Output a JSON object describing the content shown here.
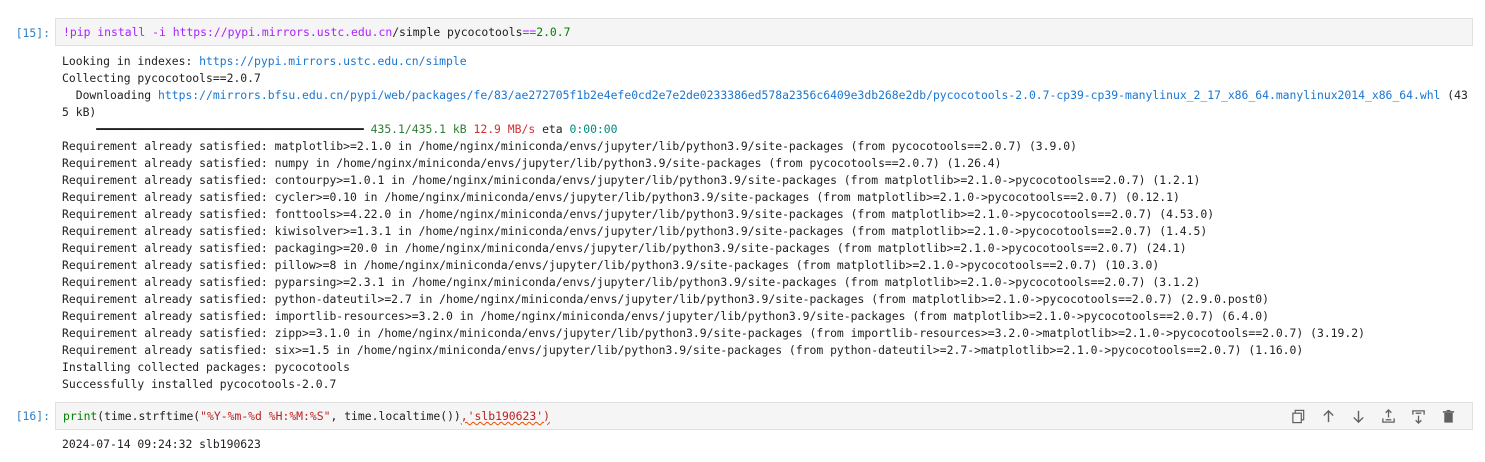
{
  "cell1": {
    "prompt": "[15]:",
    "code": {
      "magic": "!pip install -i https:",
      "sep": "//",
      "host": "pypi.mirrors.ustc.edu.cn",
      "path": "/simple pycocotools",
      "op": "==",
      "version": "2.0.7"
    },
    "output": {
      "looking_prefix": "Looking in indexes: ",
      "looking_url": "https://pypi.mirrors.ustc.edu.cn/simple",
      "collecting": "Collecting pycocotools==2.0.7",
      "downloading_prefix": "  Downloading ",
      "downloading_url": "https://mirrors.bfsu.edu.cn/pypi/web/packages/fe/83/ae272705f1b2e4efe0cd2e7e2de0233386ed578a2356c6409e3db268e2db/pycocotools-2.0.7-cp39-cp39-manylinux_2_17_x86_64.manylinux2014_x86_64.whl",
      "downloading_suffix": " (435 kB)",
      "progress": {
        "bar": "     ━━━━━━━━━━━━━━━━━━━━━━━━━━━━━━━━━━━━━━━ ",
        "size": "435.1/435.1 kB",
        "speed": "12.9 MB/s",
        "eta_label": "eta",
        "eta": "0:00:00"
      },
      "lines": [
        "Requirement already satisfied: matplotlib>=2.1.0 in /home/nginx/miniconda/envs/jupyter/lib/python3.9/site-packages (from pycocotools==2.0.7) (3.9.0)",
        "Requirement already satisfied: numpy in /home/nginx/miniconda/envs/jupyter/lib/python3.9/site-packages (from pycocotools==2.0.7) (1.26.4)",
        "Requirement already satisfied: contourpy>=1.0.1 in /home/nginx/miniconda/envs/jupyter/lib/python3.9/site-packages (from matplotlib>=2.1.0->pycocotools==2.0.7) (1.2.1)",
        "Requirement already satisfied: cycler>=0.10 in /home/nginx/miniconda/envs/jupyter/lib/python3.9/site-packages (from matplotlib>=2.1.0->pycocotools==2.0.7) (0.12.1)",
        "Requirement already satisfied: fonttools>=4.22.0 in /home/nginx/miniconda/envs/jupyter/lib/python3.9/site-packages (from matplotlib>=2.1.0->pycocotools==2.0.7) (4.53.0)",
        "Requirement already satisfied: kiwisolver>=1.3.1 in /home/nginx/miniconda/envs/jupyter/lib/python3.9/site-packages (from matplotlib>=2.1.0->pycocotools==2.0.7) (1.4.5)",
        "Requirement already satisfied: packaging>=20.0 in /home/nginx/miniconda/envs/jupyter/lib/python3.9/site-packages (from matplotlib>=2.1.0->pycocotools==2.0.7) (24.1)",
        "Requirement already satisfied: pillow>=8 in /home/nginx/miniconda/envs/jupyter/lib/python3.9/site-packages (from matplotlib>=2.1.0->pycocotools==2.0.7) (10.3.0)",
        "Requirement already satisfied: pyparsing>=2.3.1 in /home/nginx/miniconda/envs/jupyter/lib/python3.9/site-packages (from matplotlib>=2.1.0->pycocotools==2.0.7) (3.1.2)",
        "Requirement already satisfied: python-dateutil>=2.7 in /home/nginx/miniconda/envs/jupyter/lib/python3.9/site-packages (from matplotlib>=2.1.0->pycocotools==2.0.7) (2.9.0.post0)",
        "Requirement already satisfied: importlib-resources>=3.2.0 in /home/nginx/miniconda/envs/jupyter/lib/python3.9/site-packages (from matplotlib>=2.1.0->pycocotools==2.0.7) (6.4.0)",
        "Requirement already satisfied: zipp>=3.1.0 in /home/nginx/miniconda/envs/jupyter/lib/python3.9/site-packages (from importlib-resources>=3.2.0->matplotlib>=2.1.0->pycocotools==2.0.7) (3.19.2)",
        "Requirement already satisfied: six>=1.5 in /home/nginx/miniconda/envs/jupyter/lib/python3.9/site-packages (from python-dateutil>=2.7->matplotlib>=2.1.0->pycocotools==2.0.7) (1.16.0)",
        "Installing collected packages: pycocotools",
        "Successfully installed pycocotools-2.0.7"
      ]
    }
  },
  "cell2": {
    "prompt": "[16]:",
    "code": {
      "fn": "print",
      "p1": "(time.strftime(",
      "fmt": "\"%Y-%m-%d %H:%M:%S\"",
      "p2": ", time.localtime())",
      "squig": ",'slb190623')",
      "tail": ""
    },
    "output": "2024-07-14 09:24:32 slb190623",
    "toolbar": {
      "icons": [
        "duplicate-icon",
        "arrow-up-icon",
        "arrow-down-icon",
        "insert-above-icon",
        "insert-below-icon",
        "trash-icon"
      ]
    }
  },
  "colors": {
    "prompt": "#307fc1",
    "link": "#1976d2",
    "magic": "#aa22ff",
    "number": "#008000",
    "string": "#ba2121",
    "speed": "#d32f2f",
    "eta": "#00897b"
  }
}
